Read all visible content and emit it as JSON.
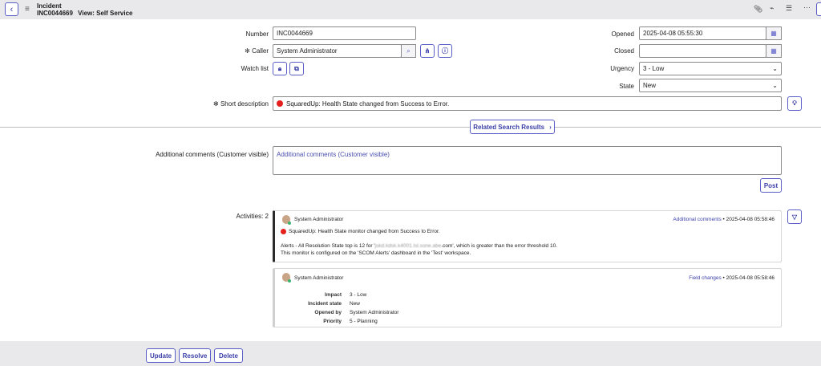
{
  "header": {
    "title": "Incident",
    "number": "INC0044669",
    "view": "View: Self Service",
    "icons": [
      "back-icon",
      "menu-icon",
      "paperclip-icon",
      "pulse-icon",
      "settings-sliders-icon",
      "more-icon"
    ]
  },
  "form": {
    "number_label": "Number",
    "number_value": "INC0044669",
    "caller_label": "Caller",
    "caller_value": "System Administrator",
    "watch_label": "Watch list",
    "opened_label": "Opened",
    "opened_value": "2025-04-08 05:55:30",
    "closed_label": "Closed",
    "closed_value": "",
    "urgency_label": "Urgency",
    "urgency_value": "3 - Low",
    "state_label": "State",
    "state_value": "New",
    "short_label": "Short description",
    "short_value": "SquaredUp: Health State changed from Success to Error.",
    "related_label": "Related Search Results",
    "comments_label": "Additional comments (Customer visible)",
    "comments_placeholder": "Additional comments (Customer visible)",
    "post_label": "Post",
    "activities_label": "Activities: 2"
  },
  "status_color": "#e5201c",
  "activities": [
    {
      "user": "System Administrator",
      "type": "Additional comments",
      "time": "2025-04-08 05:58:46",
      "title": "SquaredUp: Health State monitor changed from Success to Error.",
      "line1_pre": "Alerts - All Resolution State top is 12 for '",
      "line1_obscured": "jskd.kdsk.k4001.lsl.sone.abe",
      "line1_post": ".com', which is greater than the error threshold 10.",
      "line2": "This monitor is configured on the 'SCOM Alerts' dashboard in the 'Test' workspace."
    },
    {
      "user": "System Administrator",
      "type": "Field changes",
      "time": "2025-04-08 05:58:46",
      "fields": [
        {
          "k": "Impact",
          "v": "3 - Low"
        },
        {
          "k": "Incident state",
          "v": "New"
        },
        {
          "k": "Opened by",
          "v": "System Administrator"
        },
        {
          "k": "Priority",
          "v": "5 - Planning"
        }
      ]
    }
  ],
  "footer": {
    "update": "Update",
    "resolve": "Resolve",
    "delete": "Delete"
  }
}
